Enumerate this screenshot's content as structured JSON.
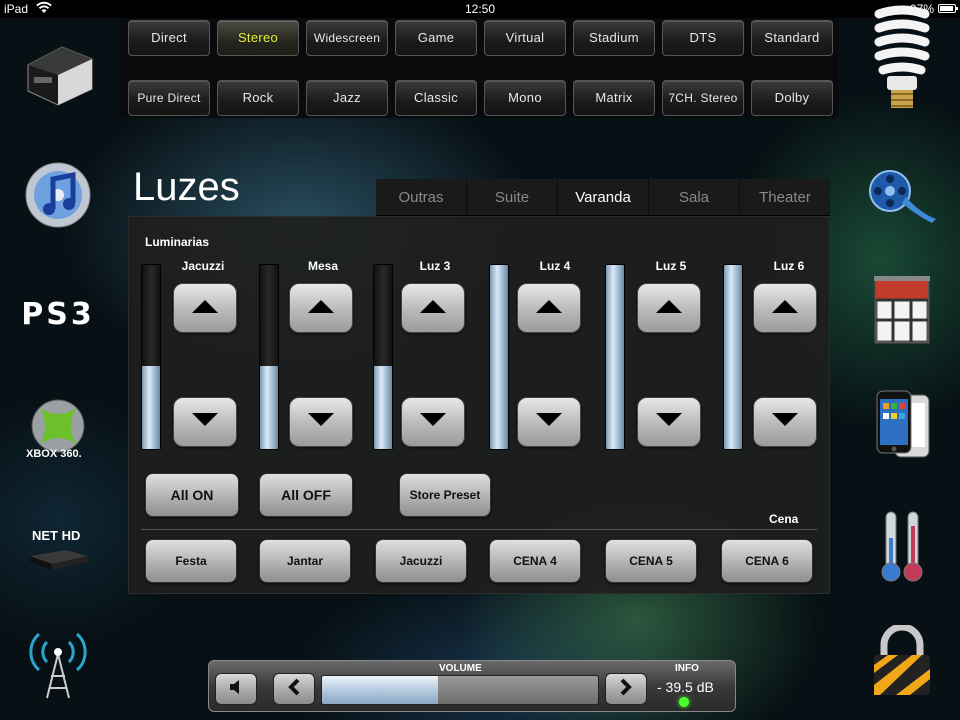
{
  "status_bar": {
    "carrier": "iPad",
    "time": "12:50",
    "battery": "97%"
  },
  "sound_modes": {
    "row1": [
      "Direct",
      "Stereo",
      "Widescreen",
      "Game",
      "Virtual",
      "Stadium",
      "DTS",
      "Standard"
    ],
    "row2": [
      "Pure Direct",
      "Rock",
      "Jazz",
      "Classic",
      "Mono",
      "Matrix",
      "7CH. Stereo",
      "Dolby"
    ],
    "active": "Stereo"
  },
  "left_icons": [
    "projector-icon",
    "itunes-icon",
    "ps3-icon",
    "xbox360-icon",
    "nethd-icon",
    "antenna-icon"
  ],
  "left_icon_labels": {
    "ps3": "PS3",
    "xbox": "XBOX 360.",
    "nethd": "NET HD"
  },
  "right_icons": [
    "light-bulb-icon",
    "film-reel-icon",
    "window-shade-icon",
    "iphone-icon",
    "thermometer-icon",
    "padlock-icon"
  ],
  "page": {
    "title": "Luzes",
    "tabs": [
      "Outras",
      "Suite",
      "Varanda",
      "Sala",
      "Theater"
    ],
    "active_tab": "Varanda",
    "section_label": "Luminarias",
    "lights": [
      {
        "name": "Jacuzzi",
        "level": 0.45
      },
      {
        "name": "Mesa",
        "level": 0.45
      },
      {
        "name": "Luz 3",
        "level": 0.45
      },
      {
        "name": "Luz 4",
        "level": 1.0
      },
      {
        "name": "Luz 5",
        "level": 1.0
      },
      {
        "name": "Luz 6",
        "level": 1.0
      }
    ],
    "buttons": {
      "all_on": "All ON",
      "all_off": "All OFF",
      "store_preset": "Store Preset"
    },
    "cena_label": "Cena",
    "scenes": [
      "Festa",
      "Jantar",
      "Jacuzzi",
      "CENA 4",
      "CENA 5",
      "CENA 6"
    ]
  },
  "volume": {
    "label": "VOLUME",
    "info_label": "INFO",
    "db": "- 39.5 dB",
    "level": 0.42
  },
  "colors": {
    "active_mode": "#e6f03a",
    "led": "#4cff2a"
  }
}
